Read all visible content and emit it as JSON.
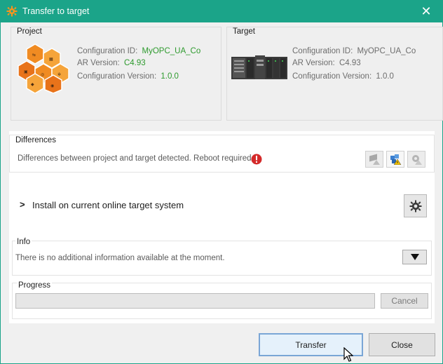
{
  "window": {
    "title": "Transfer to target",
    "close_glyph": "✕",
    "accent_color": "#1ba489"
  },
  "project": {
    "group_label": "Project",
    "config_id_label": "Configuration ID:",
    "config_id_value": "MyOPC_UA_Co",
    "ar_version_label": "AR Version:",
    "ar_version_value": "C4.93",
    "config_version_label": "Configuration Version:",
    "config_version_value": "1.0.0",
    "icon": "project-hexagons-icon"
  },
  "target": {
    "group_label": "Target",
    "config_id_label": "Configuration ID:",
    "config_id_value": "MyOPC_UA_Co",
    "ar_version_label": "AR Version:",
    "ar_version_value": "C4.93",
    "config_version_label": "Configuration Version:",
    "config_version_value": "1.0.0",
    "icon": "plc-hardware-icon"
  },
  "differences": {
    "group_label": "Differences",
    "message": "Differences between project and target detected. Reboot required.",
    "status_color": "#d42a2a"
  },
  "install": {
    "chevron": ">",
    "label": "Install on current online target system"
  },
  "info": {
    "group_label": "Info",
    "message": "There is no additional information available at the moment."
  },
  "progress": {
    "group_label": "Progress",
    "cancel_label": "Cancel",
    "value": 0
  },
  "footer": {
    "transfer_label": "Transfer",
    "close_label": "Close"
  }
}
